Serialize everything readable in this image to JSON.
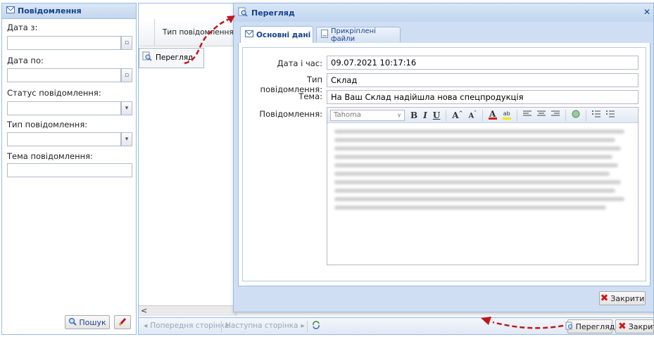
{
  "left_panel": {
    "title": "Повідомлення",
    "date_from_label": "Дата з:",
    "date_to_label": "Дата по:",
    "status_label": "Статус повідомлення:",
    "type_label": "Тип повідомлення:",
    "subject_label": "Тема повідомлення:",
    "search_button": "Пошук"
  },
  "grid": {
    "column_header": "Тип повідомлення",
    "context_menu_item": "Перегляд"
  },
  "pager": {
    "prev": "Попередня сторінка",
    "next": "Наступна сторінка"
  },
  "bottom_toolbar": {
    "view_button": "Перегляд",
    "close_button": "Закрити"
  },
  "dialog": {
    "title": "Перегляд",
    "tabs": [
      "Основні дані",
      "Прикріплені файли"
    ],
    "fields": {
      "datetime_label": "Дата і час:",
      "datetime_value": "09.07.2021 10:17:16",
      "type_label": "Тип повідомлення:",
      "type_value": "Склад",
      "subject_label": "Тема:",
      "subject_value": "На Ваш Склад надійшла нова спецпродукція",
      "message_label": "Повідомлення:"
    },
    "editor_font": "Tahoma",
    "close_button": "Закрити"
  },
  "colors": {
    "arrow": "#c0171d",
    "title_text": "#15428b",
    "border": "#99bbe8"
  }
}
